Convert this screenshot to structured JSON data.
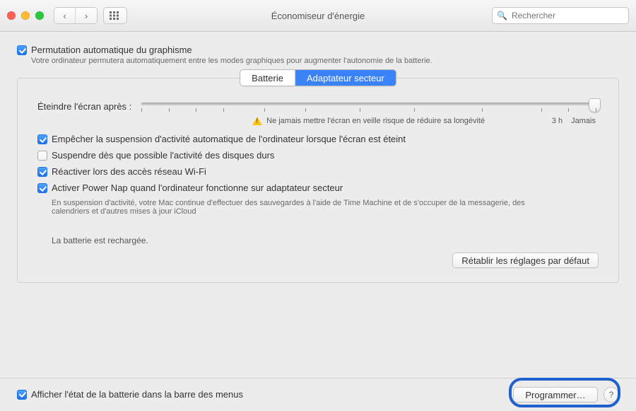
{
  "window": {
    "title": "Économiseur d'énergie",
    "search_placeholder": "Rechercher"
  },
  "top": {
    "auto_graphics_label": "Permutation automatique du graphisme",
    "auto_graphics_desc": "Votre ordinateur permutera automatiquement entre les modes graphiques pour augmenter l'autonomie de la batterie."
  },
  "tabs": {
    "battery": "Batterie",
    "adapter": "Adaptateur secteur"
  },
  "slider": {
    "label": "Éteindre l'écran après :",
    "warning": "Ne jamais mettre l'écran en veille risque de réduire sa longévité",
    "tick_3h": "3 h",
    "tick_never": "Jamais"
  },
  "checks": {
    "prevent_sleep": "Empêcher la suspension d'activité automatique de l'ordinateur lorsque l'écran est éteint",
    "disk_sleep": "Suspendre dès que possible l'activité des disques durs",
    "wake_wifi": "Réactiver lors des accès réseau Wi-Fi",
    "power_nap": "Activer Power Nap quand l'ordinateur fonctionne sur adaptateur secteur",
    "power_nap_desc": "En suspension d'activité, votre Mac continue d'effectuer des sauvegardes à l'aide de Time Machine et de s'occuper de la messagerie, des calendriers et d'autres mises à jour iCloud"
  },
  "status": "La batterie est rechargée.",
  "buttons": {
    "restore": "Rétablir les réglages par défaut",
    "schedule": "Programmer…"
  },
  "footer": {
    "show_battery": "Afficher l'état de la batterie dans la barre des menus"
  }
}
